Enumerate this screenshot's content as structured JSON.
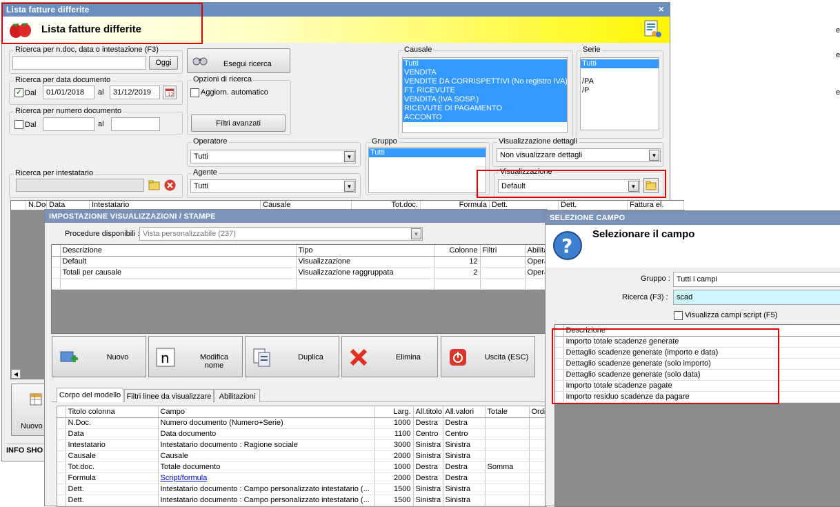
{
  "main_window": {
    "title": "Lista fatture differite",
    "header_title": "Lista fatture differite",
    "close_glyph": "×",
    "search_ndoc": {
      "legend": "Ricerca per n.doc, data o intestazione (F3)",
      "value": "",
      "btn": "Oggi"
    },
    "search_btn": "Esegui ricerca",
    "date_search": {
      "legend": "Ricerca per data documento",
      "from_label": "Dal",
      "from": "01/01/2018",
      "to_label": "al",
      "to": "31/12/2019",
      "checked": true
    },
    "num_search": {
      "legend": "Ricerca per numero documento",
      "from_label": "Dal",
      "to_label": "al",
      "checked": false
    },
    "options": {
      "legend": "Opzioni di ricerca",
      "auto_label": "Aggiorn. automatico",
      "filters_btn": "Filtri avanzati"
    },
    "causale": {
      "legend": "Causale",
      "items": [
        "Tutti",
        "VENDITA",
        "VENDITE DA CORRISPETTIVI (No registro IVA)",
        "FT. RICEVUTE",
        "VENDITA (IVA SOSP.)",
        "RICEVUTE DI PAGAMENTO",
        "ACCONTO"
      ]
    },
    "serie": {
      "legend": "Serie",
      "items": [
        "Tutti",
        "",
        "/PA",
        "/P"
      ]
    },
    "operatore": {
      "legend": "Operatore",
      "value": "Tutti"
    },
    "gruppo": {
      "legend": "Gruppo",
      "items": [
        "Tutti"
      ]
    },
    "vis_dettagli": {
      "legend": "Visualizzazione dettagli",
      "value": "Non visualizzare dettagli"
    },
    "intestatario": {
      "legend": "Ricerca per intestatario"
    },
    "agente": {
      "legend": "Agente",
      "value": "Tutti"
    },
    "visualizzazione": {
      "legend": "Visualizzazione",
      "value": "Default"
    },
    "grid_headers": [
      "",
      "N.Doc.",
      "Data",
      "Intestatario",
      "Causale",
      "Tot.doc.",
      "Formula",
      "Dett.",
      "Dett.",
      "Fattura el."
    ],
    "new_btn": "Nuovo",
    "info_label": "INFO SHO"
  },
  "impostazione": {
    "title": "IMPOSTAZIONE VISUALIZZAZIONI / STAMPE",
    "procedure_label": "Procedure disponibili :",
    "procedure_value": "Vista personalizzabile (237)",
    "headers": [
      "Descrizione",
      "Tipo",
      "Colonne",
      "Filtri",
      "Abilita"
    ],
    "rows": [
      [
        "Default",
        "Visualizzazione",
        "12",
        "",
        "Opera"
      ],
      [
        "Totali per causale",
        "Visualizzazione raggruppata",
        "2",
        "",
        "Opera"
      ]
    ],
    "buttons": [
      "Nuovo",
      "Modifica nome",
      "Duplica",
      "Elimina",
      "Uscita (ESC)"
    ],
    "tabs": [
      "Corpo del modello",
      "Filtri linee da visualizzare",
      "Abilitazioni"
    ],
    "body_headers": [
      "Titolo colonna",
      "Campo",
      "Larg.",
      "All.titolo",
      "All.valori",
      "Totale",
      "Ordi"
    ],
    "body_rows": [
      [
        "N.Doc.",
        "Numero documento (Numero+Serie)",
        "1000",
        "Destra",
        "Destra",
        ""
      ],
      [
        "Data",
        "Data documento",
        "1100",
        "Centro",
        "Centro",
        ""
      ],
      [
        "Intestatario",
        "Intestatario documento : Ragione sociale",
        "3000",
        "Sinistra",
        "Sinistra",
        ""
      ],
      [
        "Causale",
        "Causale",
        "2000",
        "Sinistra",
        "Sinistra",
        ""
      ],
      [
        "Tot.doc.",
        "Totale documento",
        "1000",
        "Destra",
        "Destra",
        "Somma"
      ],
      [
        "Formula",
        "Script/formula",
        "2000",
        "Destra",
        "Destra",
        ""
      ],
      [
        "Dett.",
        "Intestatario documento : Campo personalizzato intestatario (...",
        "1500",
        "Sinistra",
        "Sinistra",
        ""
      ],
      [
        "Dett.",
        "Intestatario documento : Campo personalizzato intestatario (...",
        "1500",
        "Sinistra",
        "Sinistra",
        ""
      ]
    ]
  },
  "selezione": {
    "title": "SELEZIONE CAMPO",
    "header": "Selezionare il campo",
    "gruppo_label": "Gruppo :",
    "gruppo_value": "Tutti i campi",
    "ricerca_label": "Ricerca (F3) :",
    "ricerca_value": "scad",
    "script_label": "Visualizza campi script (F5)",
    "col_header": "Descrizione",
    "items": [
      "Importo totale scadenze generate",
      "Dettaglio scadenze generate (importo e data)",
      "Dettaglio scadenze generate (solo importo)",
      "Dettaglio scadenze generate (solo data)",
      "Importo totale scadenze pagate",
      "Importo residuo scadenze da pagare"
    ]
  },
  "right_edge_letters": [
    "e",
    "e",
    "e"
  ],
  "colors": {
    "title_bar": "#6a8fbf",
    "selection": "#3399ff",
    "highlight": "#e00000"
  }
}
